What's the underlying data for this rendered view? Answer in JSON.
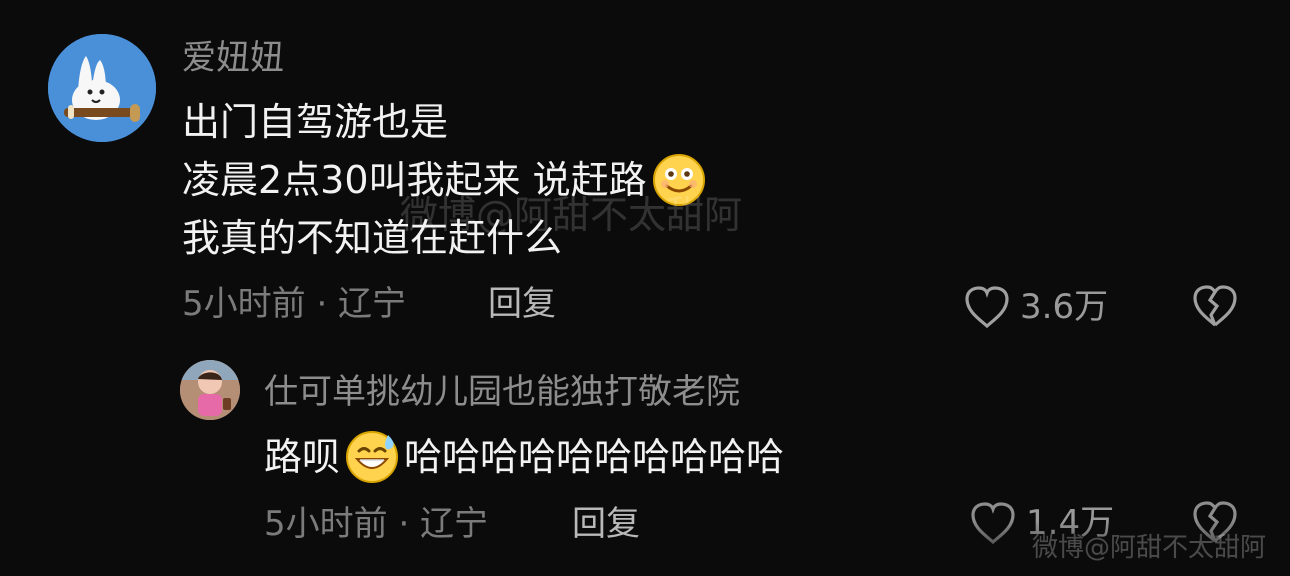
{
  "watermark": "微博@阿甜不太甜阿",
  "comment": {
    "username": "爱妞妞",
    "lines": [
      "出门自驾游也是",
      "凌晨2点30叫我起来 说赶路",
      "我真的不知道在赶什么"
    ],
    "emoji": "smiley-icon",
    "time": "5小时前",
    "location": "辽宁",
    "meta": "5小时前 · 辽宁",
    "reply_label": "回复",
    "likes": "3.6万"
  },
  "reply": {
    "username": "仕可单挑幼儿园也能独打敬老院",
    "text_before": "路呗",
    "text_after": "哈哈哈哈哈哈哈哈哈哈",
    "emoji": "sweat-smile-icon",
    "time": "5小时前",
    "location": "辽宁",
    "meta": "5小时前 · 辽宁",
    "reply_label": "回复",
    "likes": "1.4万"
  },
  "colors": {
    "background": "#0b0b0b",
    "username": "#8d8d8d",
    "text": "#f2f2f2",
    "meta": "#7b7b7b",
    "reply": "#b9b9b9"
  },
  "bottom_watermark": "微博@阿甜不太甜阿"
}
